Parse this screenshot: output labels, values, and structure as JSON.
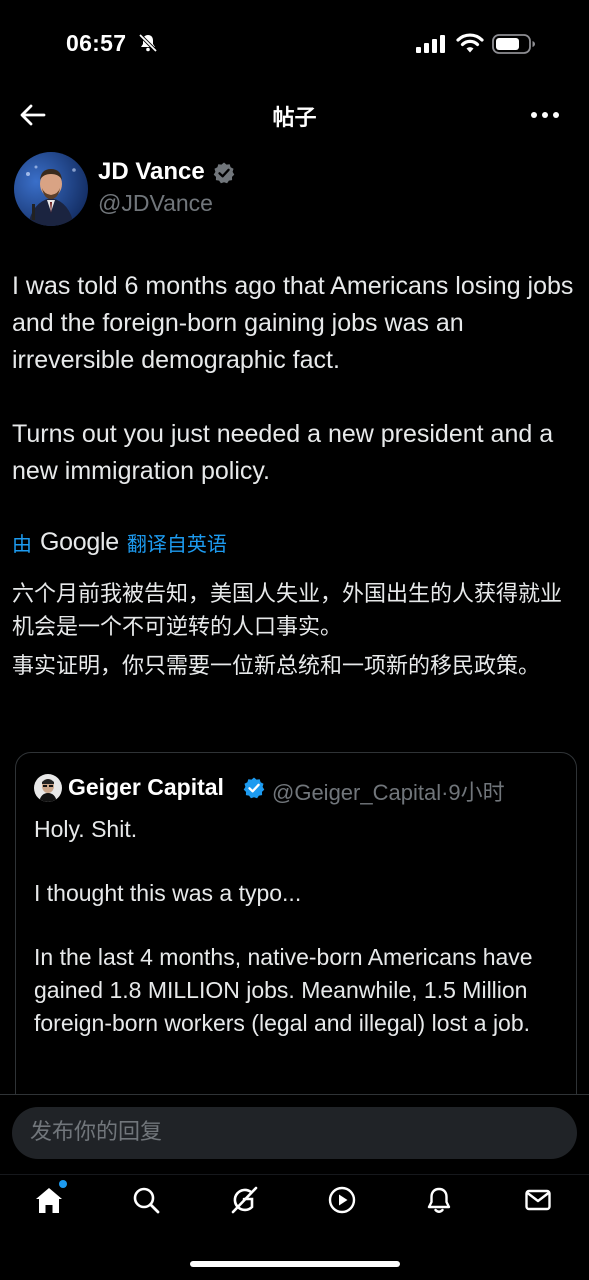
{
  "status_bar": {
    "time": "06:57"
  },
  "nav": {
    "title": "帖子"
  },
  "author": {
    "name": "JD Vance",
    "handle": "@JDVance"
  },
  "tweet": {
    "paragraphs": [
      "I was told 6 months ago that Americans losing jobs and the foreign-born gaining jobs was an irreversible demographic fact.",
      "Turns out you just needed a new president and a new immigration policy."
    ]
  },
  "translation": {
    "prefix": "由",
    "provider": "Google",
    "label": "翻译自英语",
    "paragraphs": [
      "六个月前我被告知，美国人失业，外国出生的人获得就业机会是一个不可逆转的人口事实。",
      "事实证明，你只需要一位新总统和一项新的移民政策。"
    ]
  },
  "quote": {
    "name": "Geiger Capital",
    "handle": "@Geiger_Capital",
    "separator": "·",
    "time": "9小时",
    "paragraphs": [
      "Holy. Shit.",
      "I thought this was a typo...",
      "In the last 4 months, native-born Americans have gained 1.8 MILLION jobs. Meanwhile, 1.5 Million foreign-born workers (legal and illegal) lost a job."
    ]
  },
  "reply": {
    "placeholder": "发布你的回复"
  },
  "tabs": [
    {
      "icon": "home-icon",
      "active": true,
      "has_dot": true
    },
    {
      "icon": "search-icon",
      "active": false
    },
    {
      "icon": "grok-icon",
      "active": false
    },
    {
      "icon": "video-play-icon",
      "active": false
    },
    {
      "icon": "notifications-bell-icon",
      "active": false
    },
    {
      "icon": "messages-mail-icon",
      "active": false
    }
  ],
  "colors": {
    "background": "#000000",
    "accent": "#1d9bf0",
    "muted": "#71767b",
    "text": "#e7e9ea"
  }
}
